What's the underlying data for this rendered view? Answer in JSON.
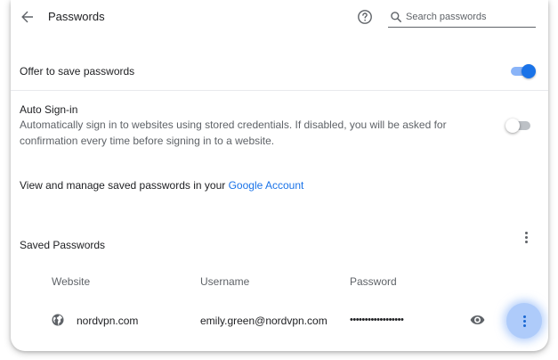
{
  "header": {
    "title": "Passwords",
    "search_placeholder": "Search passwords",
    "icons": [
      "back-arrow-icon",
      "help-icon",
      "search-icon"
    ]
  },
  "offer_to_save": {
    "label": "Offer to save passwords",
    "enabled": true
  },
  "auto_signin": {
    "label": "Auto Sign-in",
    "description": "Automatically sign in to websites using stored credentials. If disabled, you will be asked for confirmation every time before signing in to a website.",
    "enabled": false
  },
  "manage": {
    "text": "View and manage saved passwords in your ",
    "link_text": "Google Account"
  },
  "saved": {
    "title": "Saved Passwords",
    "columns": [
      "Website",
      "Username",
      "Password"
    ],
    "rows": [
      {
        "website": "nordvpn.com",
        "username": "emily.green@nordvpn.com",
        "password_mask": "••••••••••••••••••"
      }
    ]
  },
  "colors": {
    "accent": "#1a73e8",
    "toggle_track_on": "#8ab4f8",
    "toggle_off": "#bdc1c6",
    "text_primary": "#202124",
    "text_secondary": "#5f6368"
  }
}
